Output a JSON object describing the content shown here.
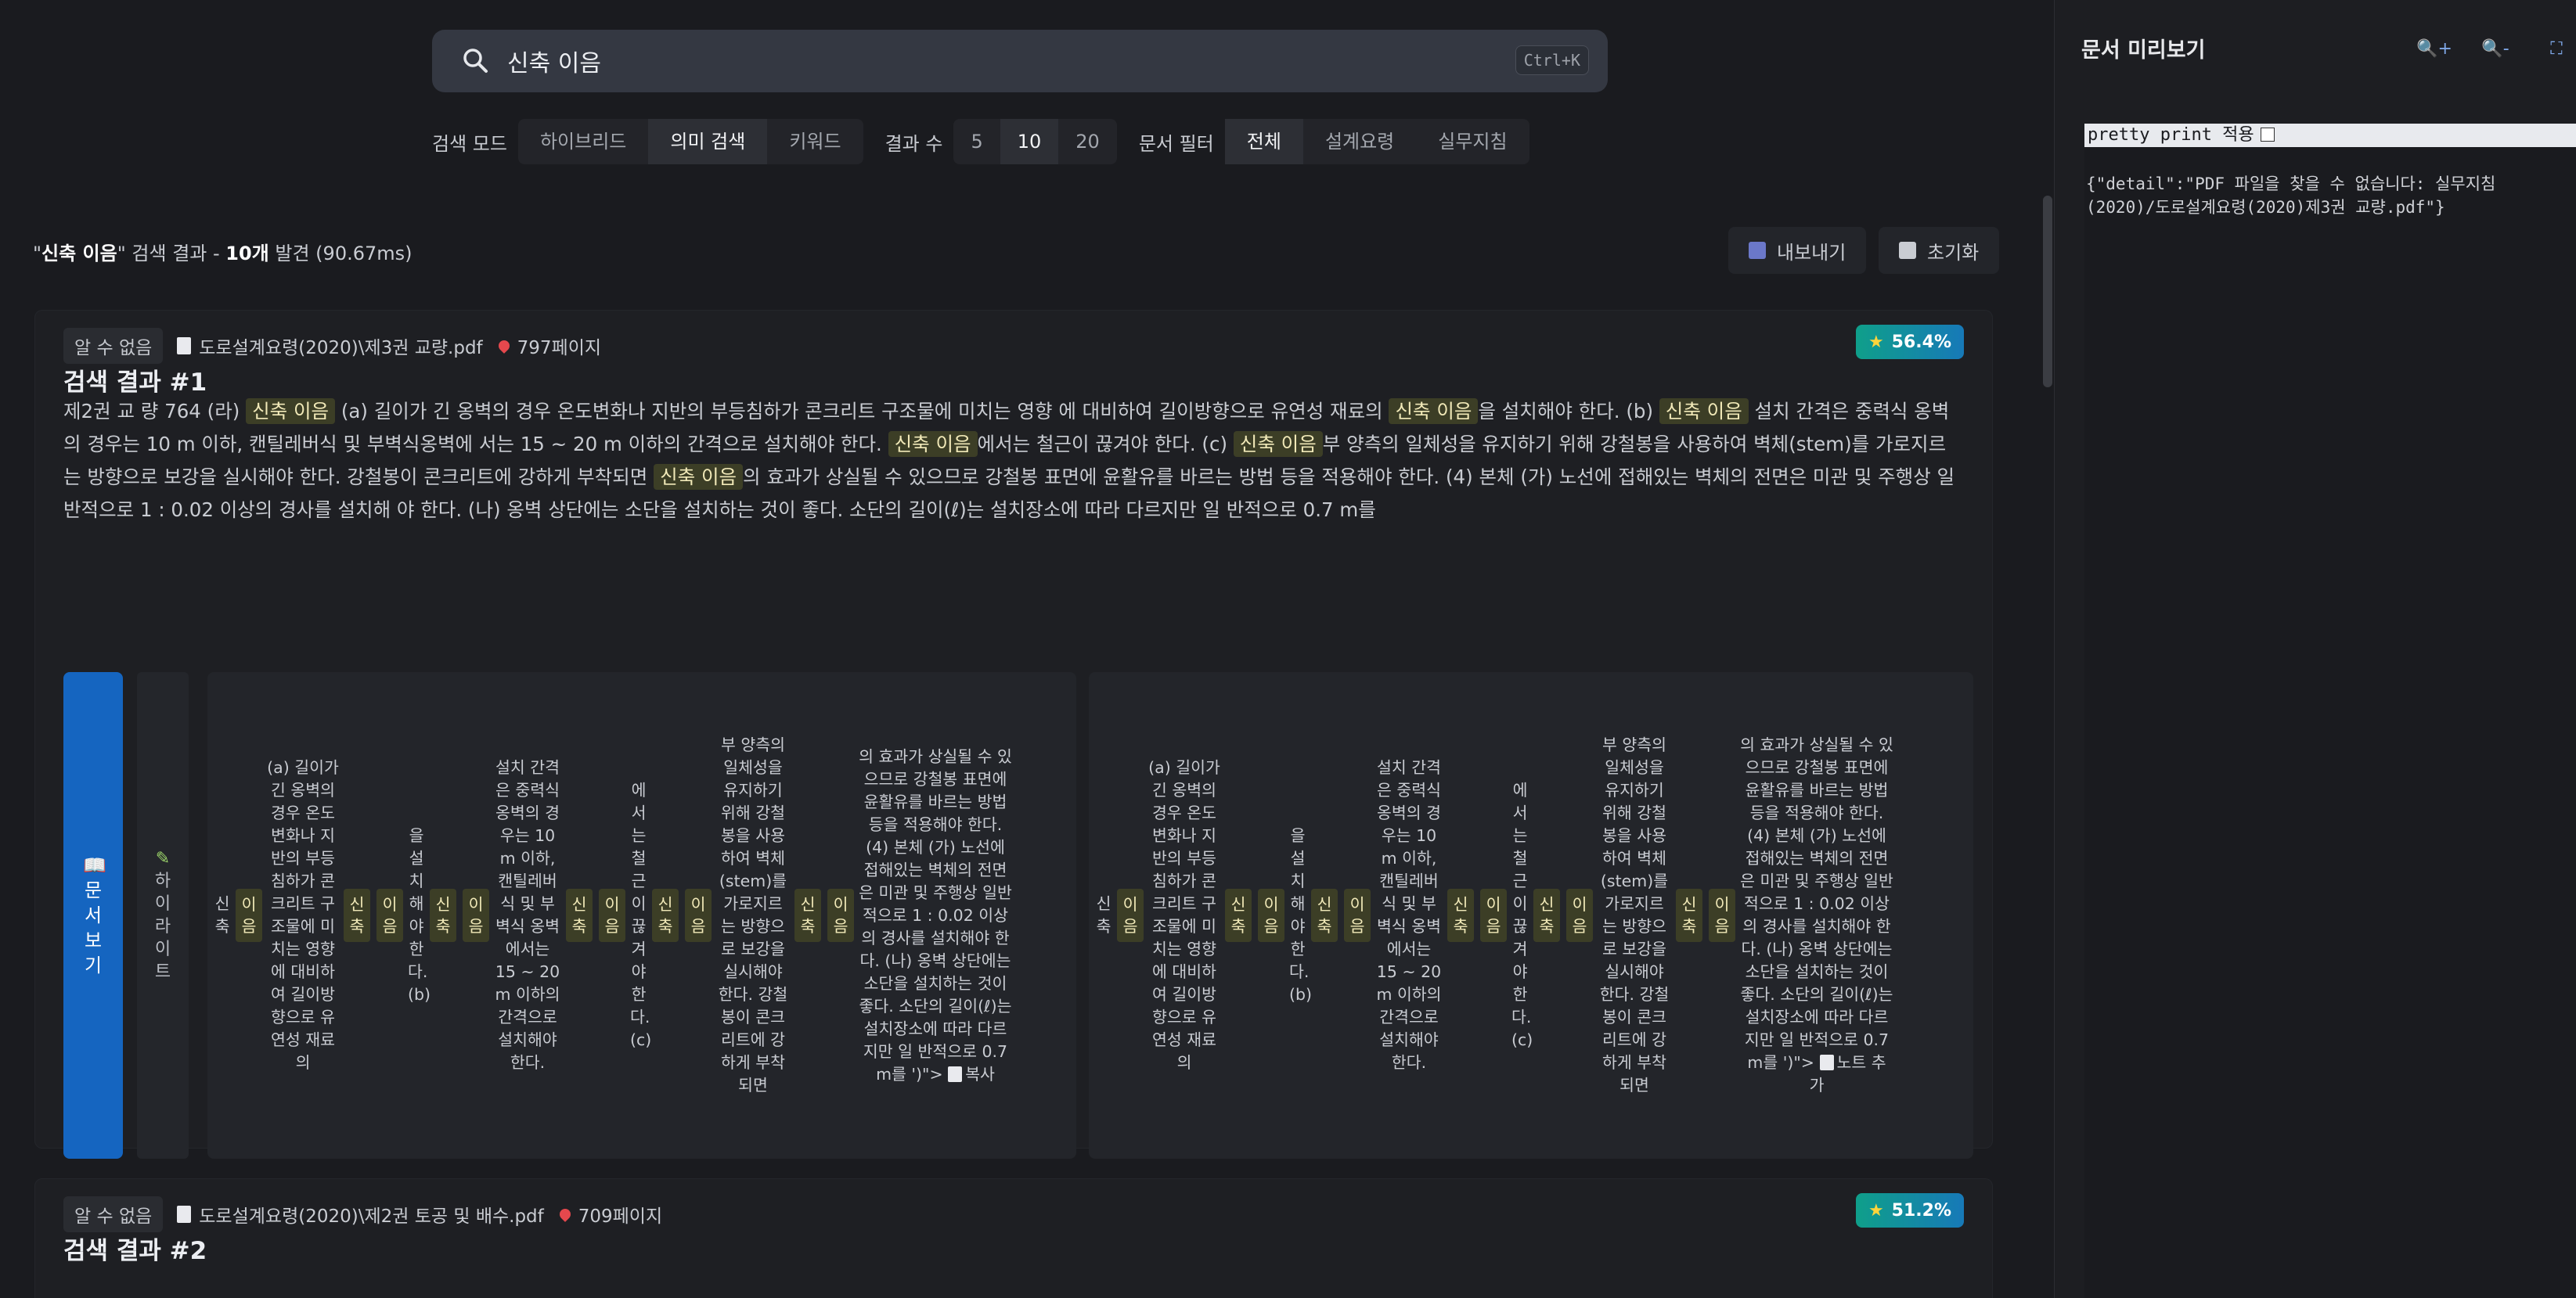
{
  "search": {
    "query": "신축 이음",
    "placeholder": "",
    "shortcut": "Ctrl+K"
  },
  "modes": {
    "search_mode_label": "검색 모드",
    "search_mode_options": [
      "하이브리드",
      "의미 검색",
      "키워드"
    ],
    "search_mode_selected": "의미 검색",
    "count_label": "결과 수",
    "count_options": [
      "5",
      "10",
      "20"
    ],
    "count_selected": "10",
    "filter_label": "문서 필터",
    "filter_options": [
      "전체",
      "설계요령",
      "실무지침"
    ],
    "filter_selected": "전체"
  },
  "summary": {
    "query_quoted": "신축 이음",
    "suffix": "\" 검색 결과 - ",
    "count": "10개",
    "found": " 발견 (90.67ms)"
  },
  "toolbar": {
    "export_label": "내보내기",
    "reset_label": "초기화"
  },
  "results": [
    {
      "chip": "알 수 없음",
      "file": "도로설계요령(2020)\\제3권 교량.pdf",
      "page": "797페이지",
      "title": "검색 결과 #1",
      "score": "56.4%",
      "snippet": [
        [
          "t",
          "제2권 교 량 764 (라) "
        ],
        [
          "h",
          "신축 이음"
        ],
        [
          "t",
          " (a) 길이가 긴 옹벽의 경우 온도변화나 지반의 부등침하가 콘크리트 구조물에 미치는 영향 에 대비하여 길이방향으로 유연성 재료의 "
        ],
        [
          "h",
          "신축 이음"
        ],
        [
          "t",
          "을 설치해야 한다. (b) "
        ],
        [
          "h",
          "신축 이음"
        ],
        [
          "t",
          " 설치 간격은 중력식 옹벽의 경우는 10 m 이하, 캔틸레버식 및 부벽식옹벽에 서는 15 ~ 20 m 이하의 간격으로 설치해야 한다. "
        ],
        [
          "h",
          "신축 이음"
        ],
        [
          "t",
          "에서는 철근이 끊겨야 한다. (c) "
        ],
        [
          "h",
          "신축 이음"
        ],
        [
          "t",
          "부 양측의 일체성을 유지하기 위해 강철봉을 사용하여 벽체(stem)를 가로지르 는 방향으로 보강을 실시해야 한다. 강철봉이 콘크리트에 강하게 부착되면 "
        ],
        [
          "h",
          "신축 이음"
        ],
        [
          "t",
          "의 효과가 상실될 수 있으므로 강철봉 표면에 윤활유를 바르는 방법 등을 적용해야 한다. (4) 본체 (가) 노선에 접해있는 벽체의 전면은 미관 및 주행상 일반적으로 1 : 0.02 이상의 경사를 설치해 야 한다. (나) 옹벽 상단에는 소단을 설치하는 것이 좋다. 소단의 길이(ℓ)는 설치장소에 따라 다르지만 일 반적으로 0.7 m를"
        ]
      ],
      "open_label": "📖 문서보기",
      "highlight_label": "하이라이트",
      "column_a": {
        "t1": "신축",
        "t2": "(a) 길이가 긴 옹벽의 경우 온도변화나 지반의 부등침하가 콘크리트 구조물에 미치는 영향에 대비하여 길이방향으로 유연성 재료의",
        "t3": "을 설치해야 한다. (b)",
        "t4": "설치 간격은 중력식 옹벽의 경우는 10 m 이하, 캔틸레버식 및 부벽식 옹벽에서는 15 ~ 20 m 이하의 간격으로 설치해야 한다.",
        "t5": "에서는 철근이 끊겨야 한다. (c)",
        "t6": "부 양측의 일체성을 유지하기 위해 강철봉을 사용하여 벽체(stem)를 가로지르는 방향으로 보강을 실시해야 한다. 강철봉이 콘크리트에 강하게 부착되면",
        "t7": "의 효과가 상실될 수 있으므로 강철봉 표면에 윤활유를 바르는 방법 등을 적용해야 한다. (4) 본체 (가) 노선에 접해있는 벽체의 전면은 미관 및 주행상 일반적으로 1 : 0.02 이상의 경사를 설치해야 한다. (나) 옹벽 상단에는 소단을 설치하는 것이 좋다. 소단의 길이(ℓ)는 설치장소에 따라 다르지만 일 반적으로 0.7 m를 ')\">",
        "action": "복사",
        "hl_words": [
          "이음",
          "신축",
          "이음",
          "신축",
          "이음",
          "신축",
          "이음",
          "신축",
          "이음",
          "신축",
          "이음"
        ]
      },
      "column_b": {
        "t1": "신축",
        "t2": "(a) 길이가 긴 옹벽의 경우 온도변화나 지반의 부등침하가 콘크리트 구조물에 미치는 영향에 대비하여 길이방향으로 유연성 재료의",
        "t3": "을 설치해야 한다. (b)",
        "t4": "설치 간격은 중력식 옹벽의 경우는 10 m 이하, 캔틸레버식 및 부벽식 옹벽에서는 15 ~ 20 m 이하의 간격으로 설치해야 한다.",
        "t5": "에서는 철근이 끊겨야 한다. (c)",
        "t6": "부 양측의 일체성을 유지하기 위해 강철봉을 사용하여 벽체(stem)를 가로지르는 방향으로 보강을 실시해야 한다. 강철봉이 콘크리트에 강하게 부착되면",
        "t7": "의 효과가 상실될 수 있으므로 강철봉 표면에 윤활유를 바르는 방법 등을 적용해야 한다. (4) 본체 (가) 노선에 접해있는 벽체의 전면은 미관 및 주행상 일반적으로 1 : 0.02 이상의 경사를 설치해야 한다. (나) 옹벽 상단에는 소단을 설치하는 것이 좋다. 소단의 길이(ℓ)는 설치장소에 따라 다르지만 일 반적으로 0.7 m를 ')\">",
        "action": "노트 추가",
        "hl_words": [
          "이음",
          "신축",
          "이음",
          "신축",
          "이음",
          "신축",
          "이음",
          "신축",
          "이음",
          "신축",
          "이음"
        ]
      }
    },
    {
      "chip": "알 수 없음",
      "file": "도로설계요령(2020)\\제2권 토공 및 배수.pdf",
      "page": "709페이지",
      "title": "검색 결과 #2",
      "score": "51.2%"
    }
  ],
  "preview": {
    "title": "문서 미리보기",
    "zoom_in": "+",
    "zoom_out": "-",
    "pretty_print_label": "pretty print 적용",
    "json_body": "{\"detail\":\"PDF 파일을 찾을 수 없습니다: 실무지침\n(2020)/도로설계요령(2020)제3권 교량.pdf\"}"
  },
  "colors": {
    "background": "#1a1b1f",
    "accent": "#1565c0",
    "highlight_bg": "#3c3e26",
    "score_gradient_start": "#0f9f8a",
    "score_gradient_end": "#1779b8"
  }
}
